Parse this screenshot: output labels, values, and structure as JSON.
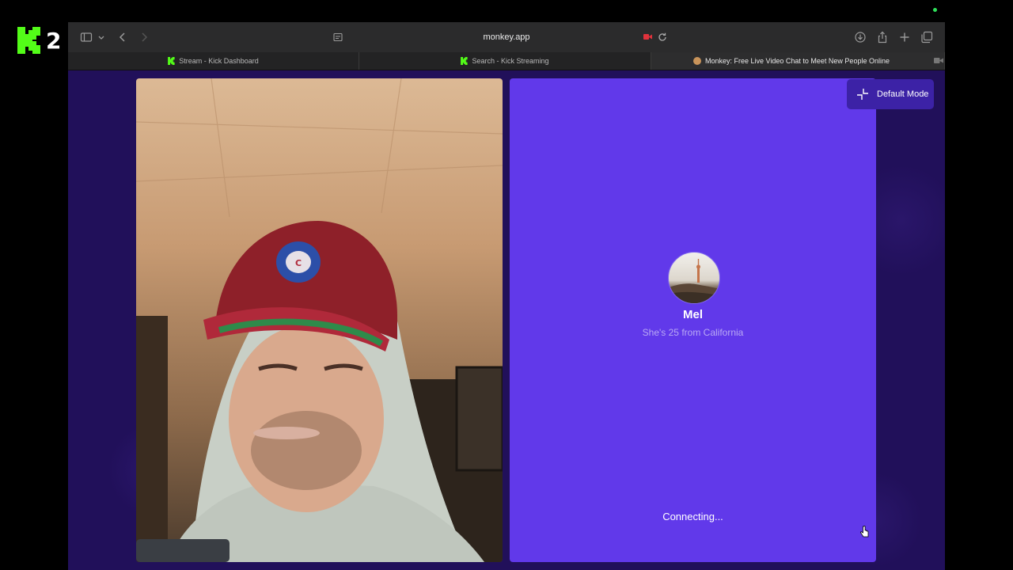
{
  "overlay": {
    "logo_number": "2"
  },
  "browser": {
    "url": "monkey.app",
    "tabs": [
      {
        "label": "Stream - Kick Dashboard",
        "active": false
      },
      {
        "label": "Search - Kick Streaming",
        "active": false
      },
      {
        "label": "Monkey: Free Live Video Chat to Meet New People Online",
        "active": true
      }
    ]
  },
  "mode_button": {
    "label": "Default Mode"
  },
  "match": {
    "name": "Mel",
    "subtitle": "She's 25 from California",
    "status": "Connecting..."
  },
  "colors": {
    "panel": "#6139ea",
    "background": "#21105a",
    "kick_green": "#53fc18"
  }
}
